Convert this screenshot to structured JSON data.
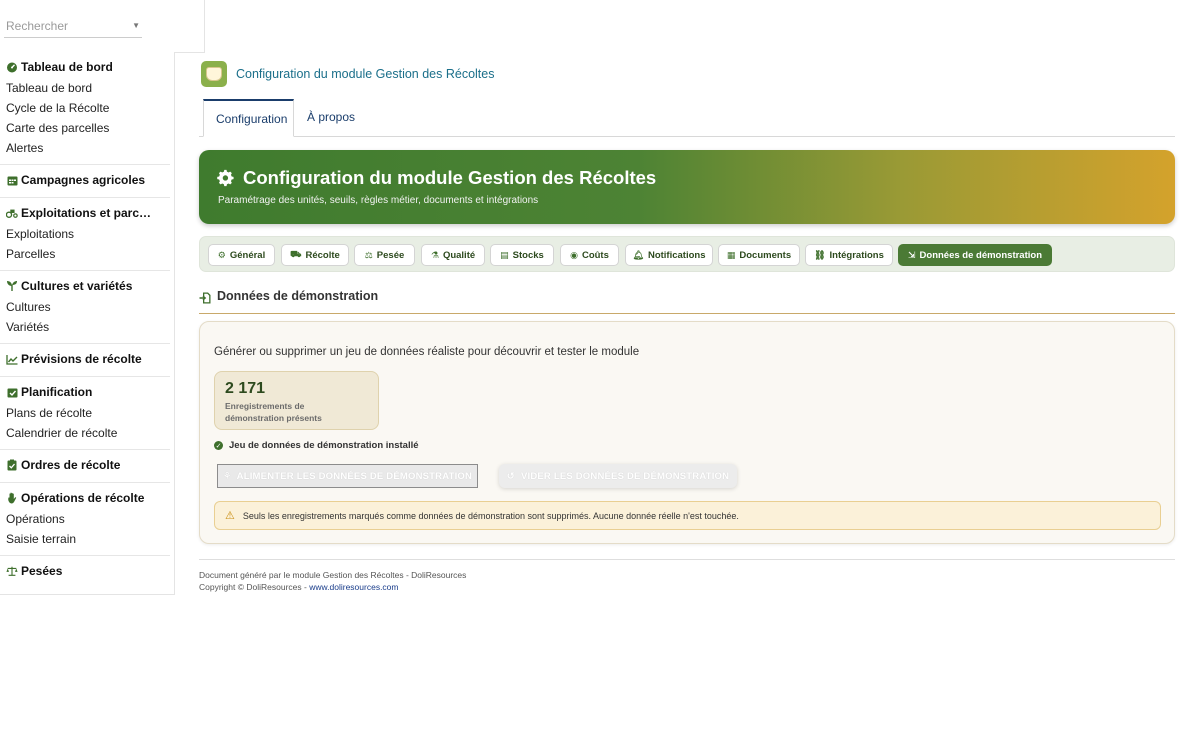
{
  "search": {
    "placeholder": "Rechercher"
  },
  "sidebar": {
    "blocks": [
      {
        "head": "Tableau de bord",
        "icon": "dashboard-icon",
        "items": [
          "Tableau de bord",
          "Cycle de la Récolte",
          "Carte des parcelles",
          "Alertes"
        ]
      },
      {
        "head": "Campagnes agricoles",
        "icon": "calendar-icon",
        "items": []
      },
      {
        "head": "Exploitations et parc…",
        "icon": "tractor-icon",
        "items": [
          "Exploitations",
          "Parcelles"
        ]
      },
      {
        "head": "Cultures et variétés",
        "icon": "seedling-icon",
        "items": [
          "Cultures",
          "Variétés"
        ]
      },
      {
        "head": "Prévisions de récolte",
        "icon": "chart-line-icon",
        "items": []
      },
      {
        "head": "Planification",
        "icon": "calendar-check-icon",
        "items": [
          "Plans de récolte",
          "Calendrier de récolte"
        ]
      },
      {
        "head": "Ordres de récolte",
        "icon": "clipboard-check-icon",
        "items": []
      },
      {
        "head": "Opérations de récolte",
        "icon": "hand-icon",
        "items": [
          "Opérations",
          "Saisie terrain"
        ]
      },
      {
        "head": "Pesées",
        "icon": "scale-icon",
        "items": []
      }
    ]
  },
  "header": {
    "title": "Configuration du module Gestion des Récoltes"
  },
  "tabs": [
    {
      "label": "Configuration"
    },
    {
      "label": "À propos"
    }
  ],
  "banner": {
    "title": "Configuration du module Gestion des Récoltes",
    "subtitle": "Paramétrage des unités, seuils, règles métier, documents et intégrations"
  },
  "subtabs": [
    {
      "label": "Général",
      "icon": "gear-icon"
    },
    {
      "label": "Récolte",
      "icon": "tractor-icon"
    },
    {
      "label": "Pesée",
      "icon": "scale-icon"
    },
    {
      "label": "Qualité",
      "icon": "flask-icon"
    },
    {
      "label": "Stocks",
      "icon": "warehouse-icon"
    },
    {
      "label": "Coûts",
      "icon": "coins-icon"
    },
    {
      "label": "Notifications",
      "icon": "bell-icon"
    },
    {
      "label": "Documents",
      "icon": "documents-icon"
    },
    {
      "label": "Intégrations",
      "icon": "network-icon"
    },
    {
      "label": "Données de démonstration",
      "icon": "file-import-icon"
    }
  ],
  "section": {
    "title": "Données de démonstration"
  },
  "card": {
    "description": "Générer ou supprimer un jeu de données réaliste pour découvrir et tester le module",
    "count": "2 171",
    "count_label": "Enregistrements de démonstration présents",
    "installed_label": "Jeu de données de démonstration installé",
    "feed_button": "ALIMENTER LES DONNÉES DE DÉMONSTRATION",
    "clear_button": "VIDER LES DONNÉES DE DÉMONSTRATION",
    "warning": "Seuls les enregistrements marqués comme données de démonstration sont supprimés. Aucune donnée réelle n'est touchée."
  },
  "footer": {
    "line1": "Document généré par le module Gestion des Récoltes - DoliResources",
    "copyright": "Copyright © DoliResources - ",
    "link": "www.doliresources.com"
  },
  "colors": {
    "accent_green": "#4b7a35",
    "accent_gold": "#d4a22c",
    "link_teal": "#1b6f8a"
  }
}
